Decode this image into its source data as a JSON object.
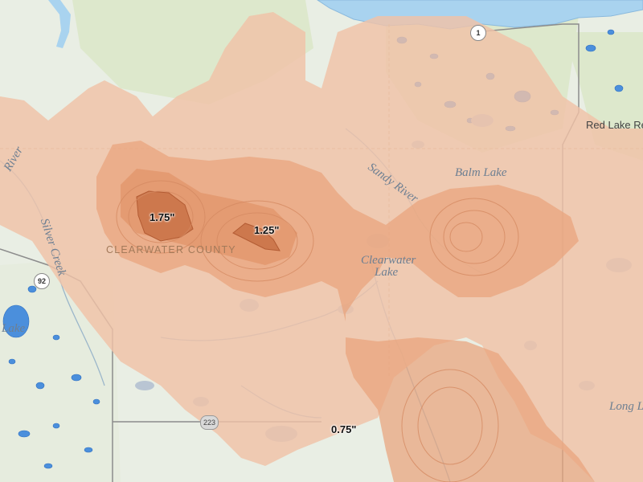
{
  "colors": {
    "land": "#e9eee4",
    "forest": "#dfe8cf",
    "water": "#b9d8ee",
    "lake_blue": "#3f87d8",
    "river": "#9dbfd8",
    "road": "#8c8c8c",
    "county_line": "#c9b08a",
    "rain_light": "#f1c3a8",
    "rain_mid": "#e9a37c",
    "rain_heavy": "#dc8c60",
    "rain_max": "#c77146",
    "contour": "#d48a62"
  },
  "rainfall_labels": {
    "max": "1.75\"",
    "mid": "1.25\"",
    "low": "0.75\""
  },
  "place_labels": {
    "county": "CLEARWATER COUNTY",
    "clearwater_lake_1": "Clearwater",
    "clearwater_lake_2": "Lake",
    "balm_lake": "Balm Lake",
    "sandy_river": "Sandy River",
    "silver_creek": "Silver Creek",
    "river_fragment": "River",
    "lake_fragment": "Lake",
    "long_lake_fragment": "Long L",
    "red_lake": "Red Lake Re"
  },
  "road_shields": {
    "hwy_1": "1",
    "hwy_92": "92",
    "hwy_223": "223"
  }
}
